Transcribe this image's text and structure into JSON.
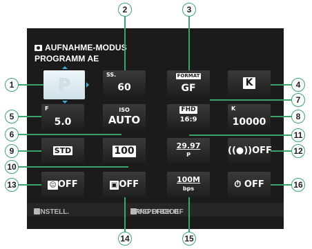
{
  "header": {
    "line1": "AUFNAHME-MODUS",
    "line2": "PROGRAMM AE"
  },
  "mode": {
    "value": "P"
  },
  "grid": {
    "ss_label": "SS.",
    "ss_value": "60",
    "format_top": "FORMAT",
    "format_value": "GF",
    "wb_value": "K",
    "f_label": "F",
    "f_value": "5.0",
    "iso_top": "ISO",
    "iso_value": "AUTO",
    "fhd_top": "FHD",
    "fhd_bottom": "16:9",
    "k_label": "K",
    "k_value": "10000",
    "film_value": "STD",
    "dr_value": "100",
    "fps_value": "29.97",
    "fps_sub": "P",
    "is_value": "OFF",
    "face_value": "OFF",
    "af_value": "OFF",
    "bitrate_value": "100M",
    "bitrate_sub": "bps",
    "timecode_value": "OFF"
  },
  "footer": {
    "left": "EINSTELL.",
    "right": "LANG DRCK B",
    "right_rest": "AR/SPEI  BEDEF"
  },
  "callouts": [
    "1",
    "2",
    "3",
    "4",
    "5",
    "6",
    "7",
    "8",
    "9",
    "10",
    "11",
    "12",
    "13",
    "14",
    "15",
    "16"
  ],
  "colors": {
    "screen": "#1b1b1b",
    "callout_border": "#3aa56a",
    "selector_arrow": "#4aa9d6",
    "selected_cell": "#e4f0f4"
  }
}
